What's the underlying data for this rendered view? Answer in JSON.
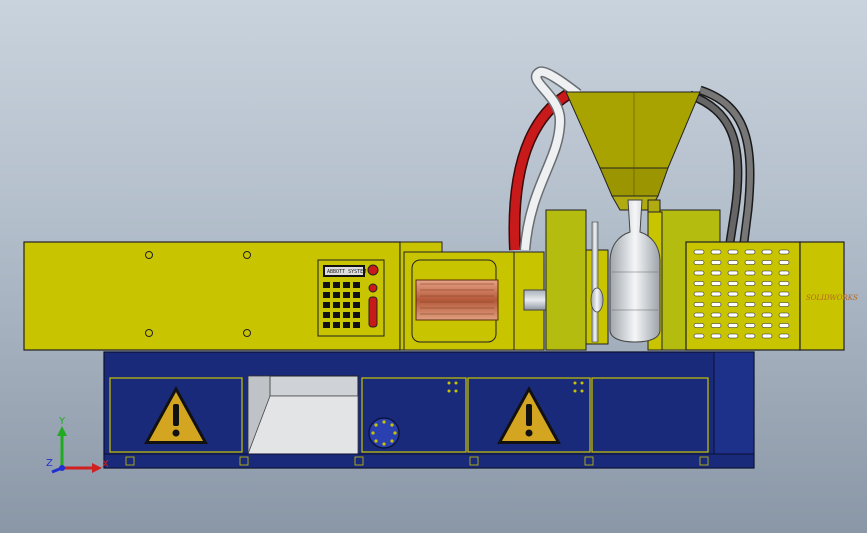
{
  "colors": {
    "machine_yellow": "#c8c400",
    "hopper_yellow": "#a8a300",
    "base_blue": "#1a2a7a",
    "warning_fill": "#d4a520",
    "red_hose": "#c81a1a",
    "grey_hose": "#555555",
    "copper": "#c46e4a"
  },
  "control_panel": {
    "display_text": "ABBOTT SYSTEM"
  },
  "heater_logo": {
    "text": "SOLIDWORKS"
  },
  "axis_triad": {
    "x_label": "X",
    "y_label": "Y",
    "z_label": "Z"
  },
  "icons": [
    "warning-icon",
    "warning-icon",
    "connector-icon"
  ]
}
